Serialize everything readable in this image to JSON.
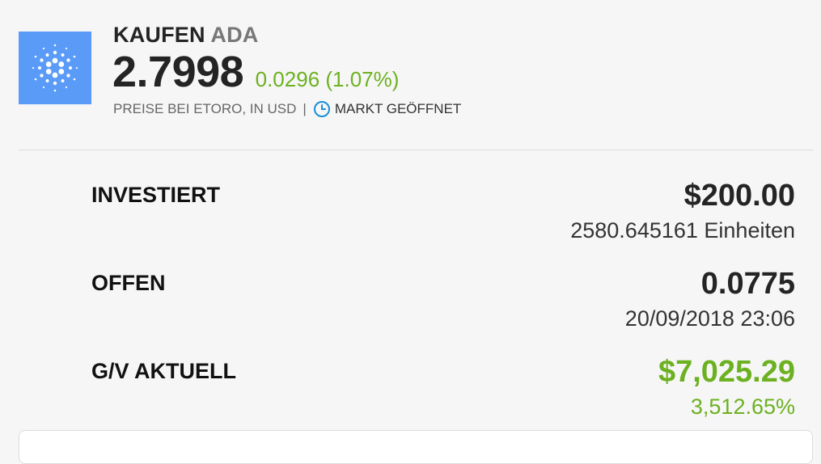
{
  "header": {
    "action": "KAUFEN",
    "symbol": "ADA",
    "price": "2.7998",
    "change": "0.0296 (1.07%)",
    "price_note": "PREISE BEI ETORO, IN USD",
    "separator": "|",
    "market_status": "MARKT GEÖFFNET",
    "logo_icon": "cardano-logo-icon",
    "accent_color": "#6cb120",
    "logo_color": "#5a9bf8"
  },
  "details": {
    "invested": {
      "label": "INVESTIERT",
      "value": "$200.00",
      "sub": "2580.645161 Einheiten"
    },
    "open": {
      "label": "OFFEN",
      "value": "0.0775",
      "sub": "20/09/2018 23:06"
    },
    "pl": {
      "label": "G/V AKTUELL",
      "value": "$7,025.29",
      "sub": "3,512.65%"
    }
  }
}
